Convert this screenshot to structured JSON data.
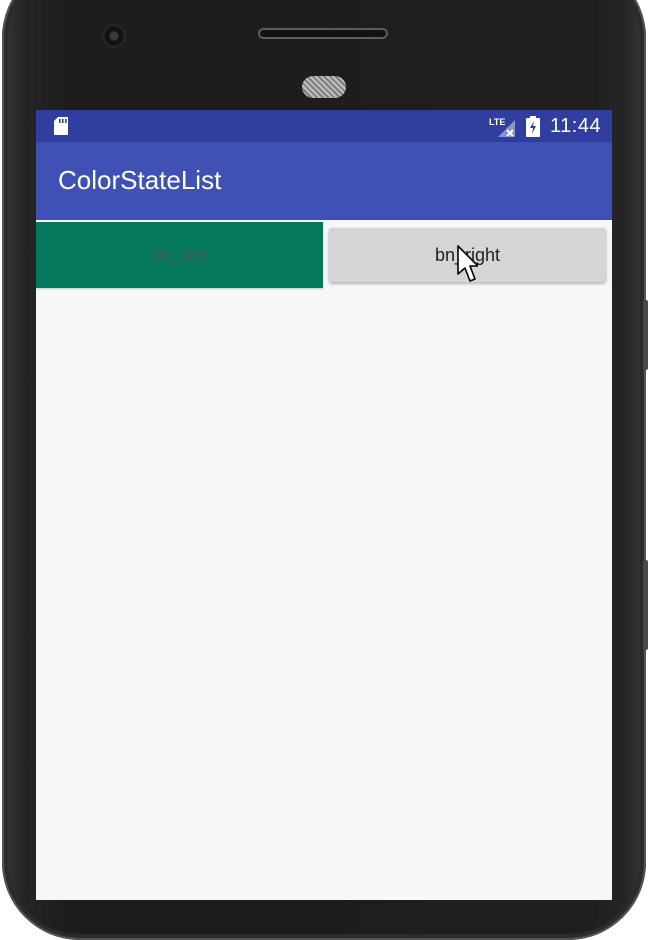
{
  "status_bar": {
    "time": "11:44",
    "icons": [
      "sd-card-icon",
      "lte-no-signal-icon",
      "battery-charging-icon"
    ],
    "color": "#303f9f"
  },
  "app_bar": {
    "title": "ColorStateList",
    "color": "#3f51b5"
  },
  "buttons": {
    "left": {
      "label": "bn_left",
      "background": "#03785a",
      "state": "checked"
    },
    "right": {
      "label": "bn_right",
      "background": "#d5d5d5",
      "state": "normal"
    }
  },
  "pointer": {
    "icon": "mouse-cursor-icon"
  }
}
